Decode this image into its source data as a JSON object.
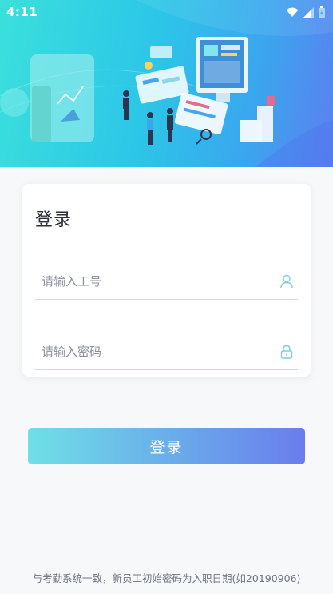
{
  "status_bar": {
    "time": "4:11",
    "icons": [
      "wifi-icon",
      "signal-icon",
      "battery-icon"
    ]
  },
  "hero": {
    "illustration": "business-dashboard-illustration"
  },
  "login_card": {
    "title": "登录",
    "employee_id": {
      "value": "",
      "placeholder": "请输入工号",
      "icon": "user-icon"
    },
    "password": {
      "value": "",
      "placeholder": "请输入密码",
      "icon": "lock-icon"
    }
  },
  "login_button": {
    "label": "登录"
  },
  "footer": {
    "hint": "与考勤系统一致，新员工初始密码为入职日期(如20190906)"
  },
  "colors": {
    "hero_start": "#3be0dc",
    "hero_end": "#5c7ff0",
    "button_start": "#6fe0e6",
    "button_end": "#6a7ded",
    "field_underline": "#bfe3ea",
    "background": "#f7f8fa"
  }
}
